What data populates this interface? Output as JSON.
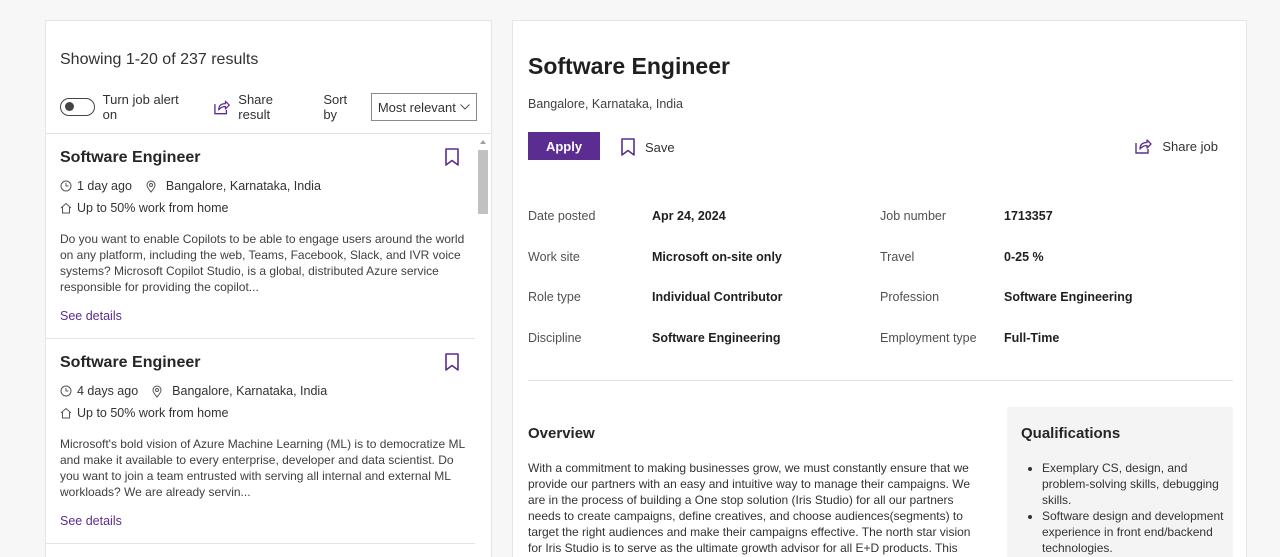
{
  "results": {
    "showing": "Showing 1-20 of 237 results",
    "alert_label": "Turn job alert on",
    "share_label": "Share result",
    "sort_label": "Sort by",
    "sort_value": "Most relevant"
  },
  "jobs": [
    {
      "title": "Software Engineer",
      "posted": "1 day ago",
      "location": "Bangalore, Karnataka, India",
      "work_mode": "Up to 50% work from home",
      "description": "Do you want to enable Copilots to be able to engage users around the world on any platform, including the web, Teams, Facebook, Slack, and IVR voice systems? Microsoft Copilot Studio, is a global, distributed Azure service responsible for providing the copilot...",
      "details_label": "See details"
    },
    {
      "title": "Software Engineer",
      "posted": "4 days ago",
      "location": "Bangalore, Karnataka, India",
      "work_mode": "Up to 50% work from home",
      "description": "Microsoft's bold vision of Azure Machine Learning (ML) is to democratize ML and make it available to every enterprise, developer and data scientist. Do you want to join a team entrusted with serving all internal and external ML workloads? We are already servin...",
      "details_label": "See details"
    }
  ],
  "detail": {
    "title": "Software Engineer",
    "location": "Bangalore, Karnataka, India",
    "apply_label": "Apply",
    "save_label": "Save",
    "share_label": "Share job",
    "facts": {
      "date_posted": {
        "label": "Date posted",
        "value": "Apr 24, 2024"
      },
      "job_number": {
        "label": "Job number",
        "value": "1713357"
      },
      "work_site": {
        "label": "Work site",
        "value": "Microsoft on-site only"
      },
      "travel": {
        "label": "Travel",
        "value": "0-25 %"
      },
      "role_type": {
        "label": "Role type",
        "value": "Individual Contributor"
      },
      "profession": {
        "label": "Profession",
        "value": "Software Engineering"
      },
      "discipline": {
        "label": "Discipline",
        "value": "Software Engineering"
      },
      "employment_type": {
        "label": "Employment type",
        "value": "Full-Time"
      }
    },
    "overview_heading": "Overview",
    "overview_text": "With a commitment to making businesses grow, we must constantly ensure that we provide our partners with an easy and intuitive way to manage their campaigns. We are in the process of building a One stop solution (Iris Studio) for all our partners needs to create campaigns, define creatives, and choose audiences(segments) to target the right audiences and make their campaigns effective. The north star vision for Iris Studio is to serve as the ultimate growth advisor for all E+D products. This",
    "qualifications_heading": "Qualifications",
    "qualifications": [
      "Exemplary CS, design, and problem-solving skills, debugging skills.",
      "Software design and development experience in front end/backend technologies."
    ]
  },
  "colors": {
    "accent": "#5c2d91"
  }
}
